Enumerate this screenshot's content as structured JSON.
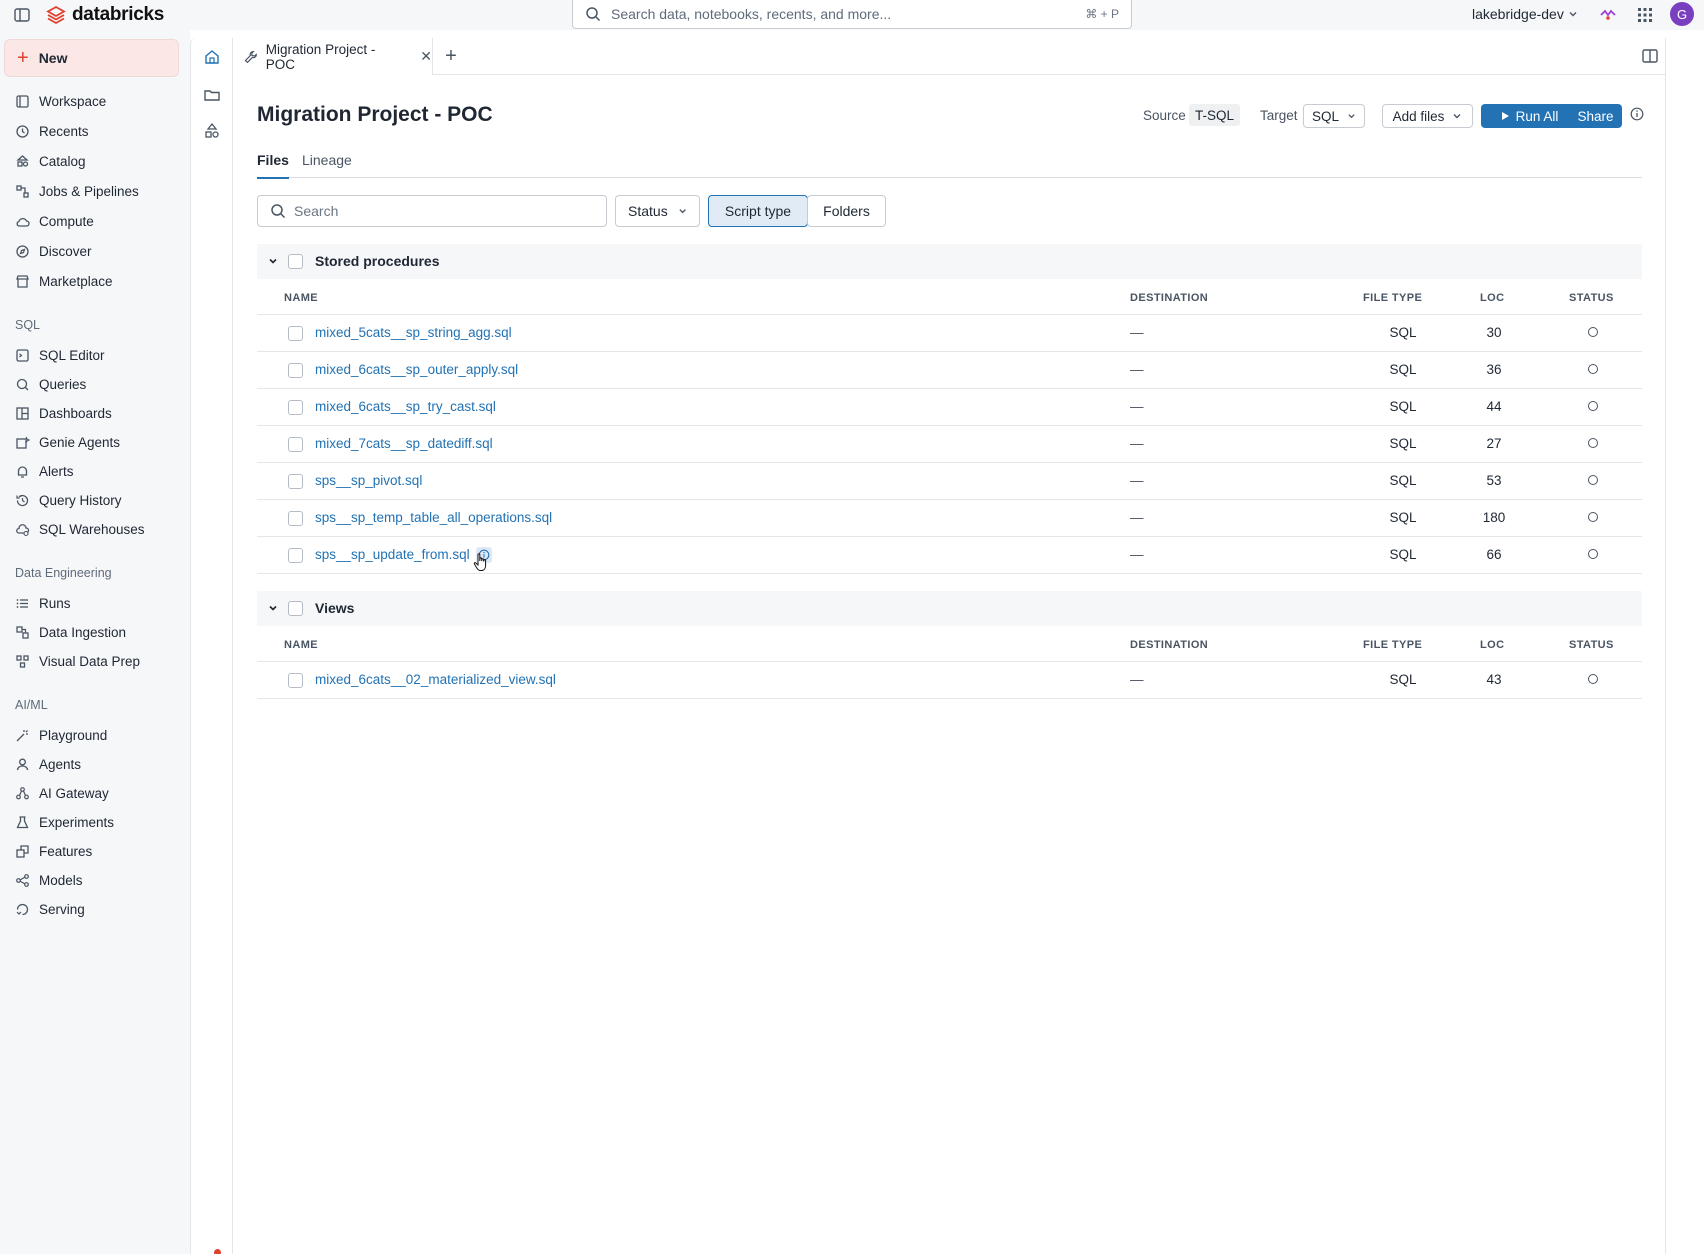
{
  "topbar": {
    "logo_text": "databricks",
    "search_placeholder": "Search data, notebooks, recents, and more...",
    "search_shortcut": "⌘ + P",
    "workspace": "lakebridge-dev",
    "avatar_initial": "G"
  },
  "sidebar": {
    "new_label": "New",
    "main_items": [
      {
        "label": "Workspace",
        "icon": "workspace-icon"
      },
      {
        "label": "Recents",
        "icon": "clock-icon"
      },
      {
        "label": "Catalog",
        "icon": "catalog-icon"
      },
      {
        "label": "Jobs & Pipelines",
        "icon": "workflow-icon"
      },
      {
        "label": "Compute",
        "icon": "cloud-icon"
      },
      {
        "label": "Discover",
        "icon": "compass-icon"
      },
      {
        "label": "Marketplace",
        "icon": "store-icon"
      }
    ],
    "sql_section": "SQL",
    "sql_items": [
      {
        "label": "SQL Editor",
        "icon": "sql-editor-icon"
      },
      {
        "label": "Queries",
        "icon": "query-icon"
      },
      {
        "label": "Dashboards",
        "icon": "dashboard-icon"
      },
      {
        "label": "Genie Agents",
        "icon": "genie-icon"
      },
      {
        "label": "Alerts",
        "icon": "bell-icon"
      },
      {
        "label": "Query History",
        "icon": "history-icon"
      },
      {
        "label": "SQL Warehouses",
        "icon": "warehouse-icon"
      }
    ],
    "de_section": "Data Engineering",
    "de_items": [
      {
        "label": "Runs",
        "icon": "list-icon"
      },
      {
        "label": "Data Ingestion",
        "icon": "ingestion-icon"
      },
      {
        "label": "Visual Data Prep",
        "icon": "data-prep-icon"
      }
    ],
    "ml_section": "AI/ML",
    "ml_items": [
      {
        "label": "Playground",
        "icon": "sparkle-icon"
      },
      {
        "label": "Agents",
        "icon": "agent-icon"
      },
      {
        "label": "AI Gateway",
        "icon": "gateway-icon"
      },
      {
        "label": "Experiments",
        "icon": "flask-icon"
      },
      {
        "label": "Features",
        "icon": "features-icon"
      },
      {
        "label": "Models",
        "icon": "model-icon"
      },
      {
        "label": "Serving",
        "icon": "serving-icon"
      }
    ]
  },
  "tabs": {
    "open_tab": "Migration Project - POC"
  },
  "page": {
    "title": "Migration Project - POC",
    "source_label": "Source",
    "source_value": "T-SQL",
    "target_label": "Target",
    "target_value": "SQL",
    "add_files_label": "Add files",
    "run_all_label": "Run All",
    "share_label": "Share",
    "tab_files": "Files",
    "tab_lineage": "Lineage",
    "search_placeholder": "Search",
    "filter_status": "Status",
    "filter_script_type": "Script type",
    "filter_folders": "Folders"
  },
  "columns": {
    "name": "NAME",
    "destination": "DESTINATION",
    "file_type": "FILE TYPE",
    "loc": "LOC",
    "status": "STATUS"
  },
  "groups": [
    {
      "name": "Stored procedures",
      "rows": [
        {
          "name": "mixed_5cats__sp_string_agg.sql",
          "destination": "—",
          "file_type": "SQL",
          "loc": "30"
        },
        {
          "name": "mixed_6cats__sp_outer_apply.sql",
          "destination": "—",
          "file_type": "SQL",
          "loc": "36"
        },
        {
          "name": "mixed_6cats__sp_try_cast.sql",
          "destination": "—",
          "file_type": "SQL",
          "loc": "44"
        },
        {
          "name": "mixed_7cats__sp_datediff.sql",
          "destination": "—",
          "file_type": "SQL",
          "loc": "27"
        },
        {
          "name": "sps__sp_pivot.sql",
          "destination": "—",
          "file_type": "SQL",
          "loc": "53"
        },
        {
          "name": "sps__sp_temp_table_all_operations.sql",
          "destination": "—",
          "file_type": "SQL",
          "loc": "180"
        },
        {
          "name": "sps__sp_update_from.sql",
          "destination": "—",
          "file_type": "SQL",
          "loc": "66"
        }
      ]
    },
    {
      "name": "Views",
      "rows": [
        {
          "name": "mixed_6cats__02_materialized_view.sql",
          "destination": "—",
          "file_type": "SQL",
          "loc": "43"
        }
      ]
    }
  ],
  "colors": {
    "accent": "#2272b4",
    "brand": "#e0402e",
    "new_button_bg": "#fbe7e6"
  }
}
